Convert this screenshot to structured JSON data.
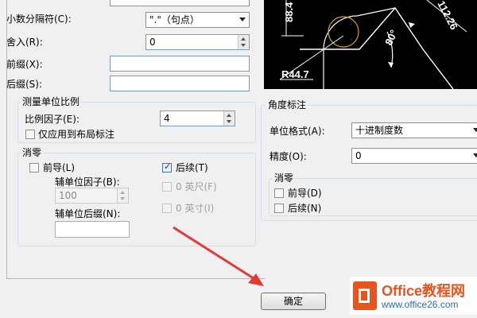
{
  "preview": {
    "dim_left": "88.4",
    "dim_right": "112.26",
    "dim_angle": "80°",
    "dim_radius": "R44.7"
  },
  "primary_units": {
    "decimal_separator_label": "小数分隔符(C):",
    "decimal_separator_value": "\".\"（句点）",
    "round_off_label": "舍入(R):",
    "round_off_value": "0",
    "prefix_label": "前缀(X):",
    "prefix_value": "",
    "suffix_label": "后缀(S):",
    "suffix_value": "",
    "scale_group_title": "测量单位比例",
    "scale_factor_label": "比例因子(E):",
    "scale_factor_value": "4",
    "layout_only_label": "仅应用到布局标注",
    "zero_suppression": {
      "title": "消零",
      "leading_label": "前导(L)",
      "sub_unit_factor_label": "辅单位因子(B):",
      "sub_unit_factor_value": "100",
      "sub_unit_suffix_label": "辅单位后缀(N):",
      "sub_unit_suffix_value": "",
      "trailing_label": "后续(T)",
      "feet_label": "0 英尺(F)",
      "inches_label": "0 英寸(I)"
    }
  },
  "angular": {
    "title": "角度标注",
    "units_format_label": "单位格式(A):",
    "units_format_value": "十进制度数",
    "precision_label": "精度(O):",
    "precision_value": "0",
    "zero_title": "消零",
    "leading_label": "前导(D)",
    "trailing_label": "后续(N)"
  },
  "buttons": {
    "ok": "确定"
  },
  "watermark": {
    "brand": "Office教程网",
    "url": "www.office26.com"
  },
  "colors": {
    "arrow": "#e53935",
    "logo": "#e8541e",
    "preview_bg": "#000000",
    "preview_line": "#ffffff",
    "preview_accent": "#d4a017"
  }
}
